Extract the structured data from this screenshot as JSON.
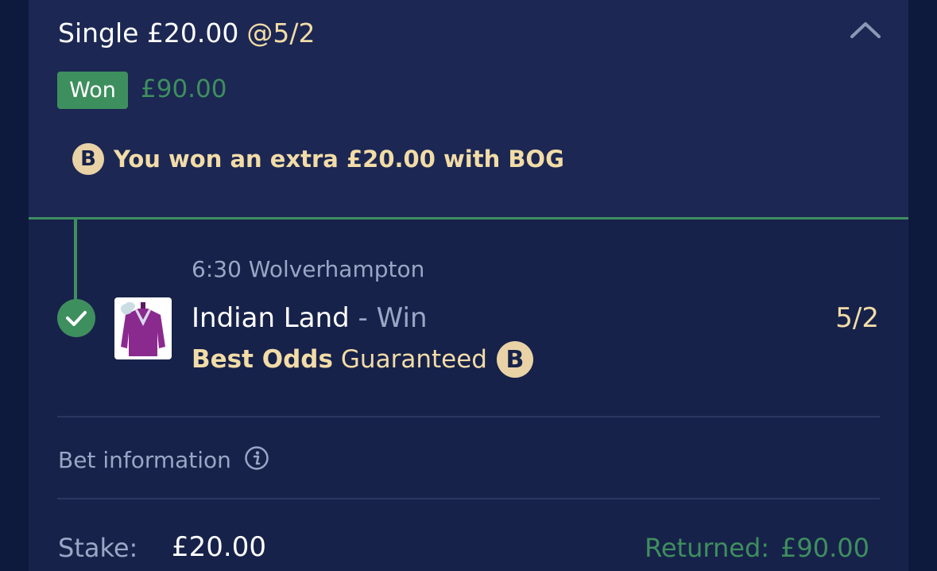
{
  "bet": {
    "type_label": "Single £20.00",
    "odds_label": "@5/2",
    "status_badge": "Won",
    "won_amount": "£90.00",
    "bog_badge_letter": "B",
    "bog_message": "You won an extra £20.00 with BOG"
  },
  "selection": {
    "event": "6:30 Wolverhampton",
    "runner": "Indian Land",
    "separator": "-",
    "market": "Win",
    "price": "5/2",
    "bog_bold": "Best Odds",
    "bog_normal": "Guaranteed",
    "bog_badge_letter": "B"
  },
  "info": {
    "label": "Bet information"
  },
  "summary": {
    "stake_label": "Stake:",
    "stake_value": "£20.00",
    "returned_label": "Returned:",
    "returned_value": "£90.00"
  },
  "icons": {
    "collapse": "chevron-up-icon",
    "settled": "check-icon",
    "info": "info-icon",
    "silks": "jockey-silks-icon"
  },
  "colors": {
    "background": "#0d1a3d",
    "card": "#17224a",
    "card_header": "#1c2753",
    "won_green": "#3e8f5e",
    "gold": "#f2dca7",
    "muted": "#9aa6c6"
  }
}
